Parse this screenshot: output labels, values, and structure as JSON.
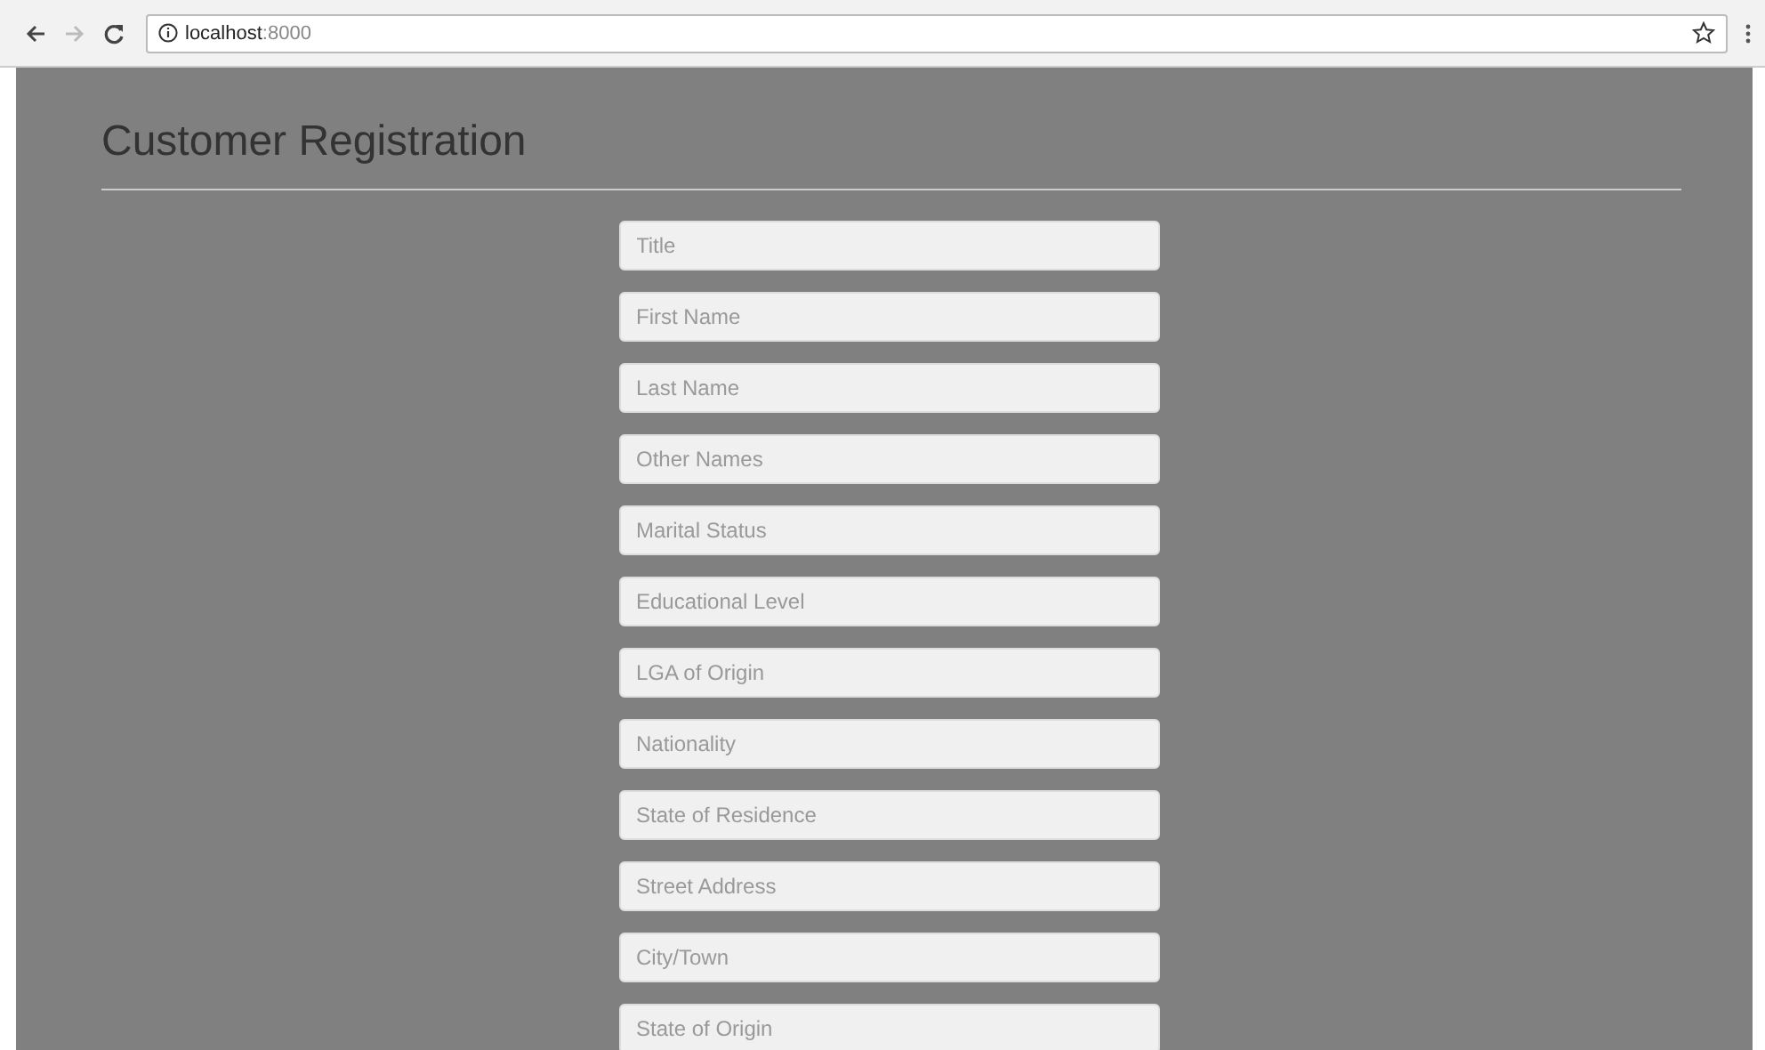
{
  "browser": {
    "url_host": "localhost",
    "url_port": ":8000"
  },
  "page": {
    "title": "Customer Registration"
  },
  "fields": [
    {
      "placeholder": "Title"
    },
    {
      "placeholder": "First Name"
    },
    {
      "placeholder": "Last Name"
    },
    {
      "placeholder": "Other Names"
    },
    {
      "placeholder": "Marital Status"
    },
    {
      "placeholder": "Educational Level"
    },
    {
      "placeholder": "LGA of Origin"
    },
    {
      "placeholder": "Nationality"
    },
    {
      "placeholder": "State of Residence"
    },
    {
      "placeholder": "Street Address"
    },
    {
      "placeholder": "City/Town"
    },
    {
      "placeholder": "State of Origin"
    }
  ]
}
